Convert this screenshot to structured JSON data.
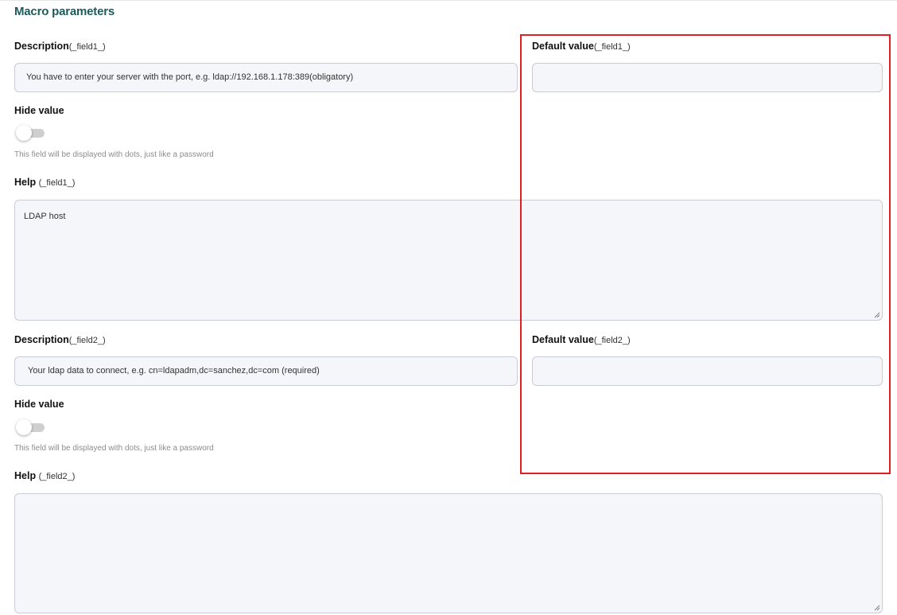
{
  "section": {
    "title": "Macro parameters"
  },
  "field1": {
    "description_label": "Description",
    "description_suffix": "(_field1_)",
    "description_value": "You have to enter your server with the port, e.g. ldap://192.168.1.178:389(obligatory)",
    "default_label": "Default value",
    "default_suffix": "(_field1_)",
    "default_value": "",
    "hide_label": "Hide value",
    "hide_toggle": "off",
    "hide_hint": "This field will be displayed with dots, just like a password",
    "help_label": "Help",
    "help_suffix": "(_field1_)",
    "help_value": "LDAP host"
  },
  "field2": {
    "description_label": "Description",
    "description_suffix": "(_field2_)",
    "description_value": "Your ldap data to connect, e.g. cn=ldapadm,dc=sanchez,dc=com (required)",
    "default_label": "Default value",
    "default_suffix": "(_field2_)",
    "default_value": "",
    "hide_label": "Hide value",
    "hide_toggle": "off",
    "hide_hint": "This field will be displayed with dots, just like a password",
    "help_label": "Help",
    "help_suffix": "(_field2_)",
    "help_value": ""
  },
  "colors": {
    "title": "#1e5a5a",
    "input_bg": "#f5f6f9",
    "input_border": "#c7ccd6",
    "highlight_border": "#e02020",
    "toggle_track": "#cfcfcf"
  }
}
